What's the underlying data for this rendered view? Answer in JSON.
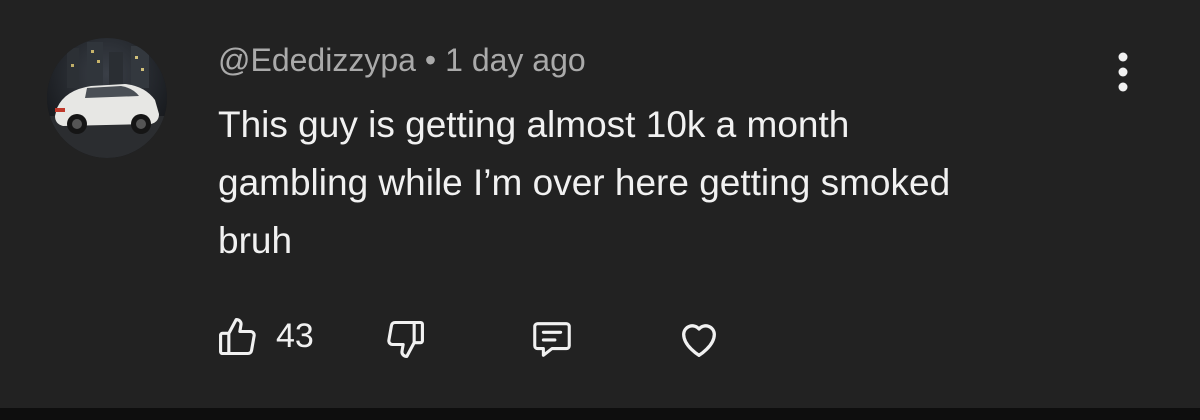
{
  "comment": {
    "author": "@Ededizzypa",
    "separator": "•",
    "timestamp": "1 day ago",
    "text_lines": [
      "This guy is getting almost 10k a month",
      "gambling while I’m over here getting smoked",
      "bruh"
    ],
    "like_count": "43"
  },
  "icons": {
    "like": "thumbs-up-icon",
    "dislike": "thumbs-down-icon",
    "reply": "reply-comment-icon",
    "heart": "heart-icon",
    "more": "more-vertical-icon"
  },
  "colors": {
    "background": "#222222",
    "meta_text": "#aaaaaa",
    "body_text": "#f1f1f1",
    "icon": "#f1f1f1"
  }
}
